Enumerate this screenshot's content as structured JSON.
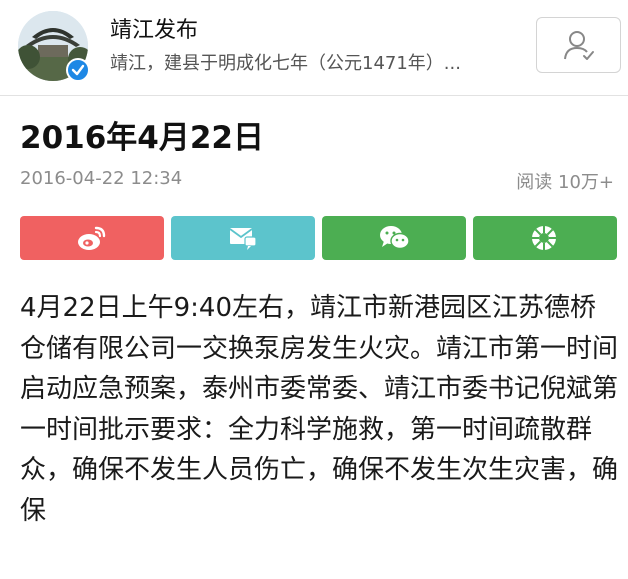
{
  "account": {
    "name": "靖江发布",
    "description": "靖江，建县于明成化七年（公元1471年）..."
  },
  "article": {
    "title": "2016年4月22日",
    "date": "2016-04-22 12:34",
    "reads": "阅读 10万+",
    "body": "4月22日上午9:40左右，靖江市新港园区江苏德桥仓储有限公司一交换泵房发生火灾。靖江市第一时间启动应急预案，泰州市委常委、靖江市委书记倪斌第一时间批示要求：全力科学施救，第一时间疏散群众，确保不发生人员伤亡，确保不发生次生灾害，确保"
  },
  "share": {
    "buttons": [
      {
        "icon": "weibo-icon",
        "color": "#f06161"
      },
      {
        "icon": "message-icon",
        "color": "#5cc4cc"
      },
      {
        "icon": "wechat-icon",
        "color": "#4cae52"
      },
      {
        "icon": "moments-icon",
        "color": "#4cae52"
      }
    ]
  },
  "colors": {
    "accent_blue": "#1e88e5",
    "meta_gray": "#8c8c8c"
  }
}
